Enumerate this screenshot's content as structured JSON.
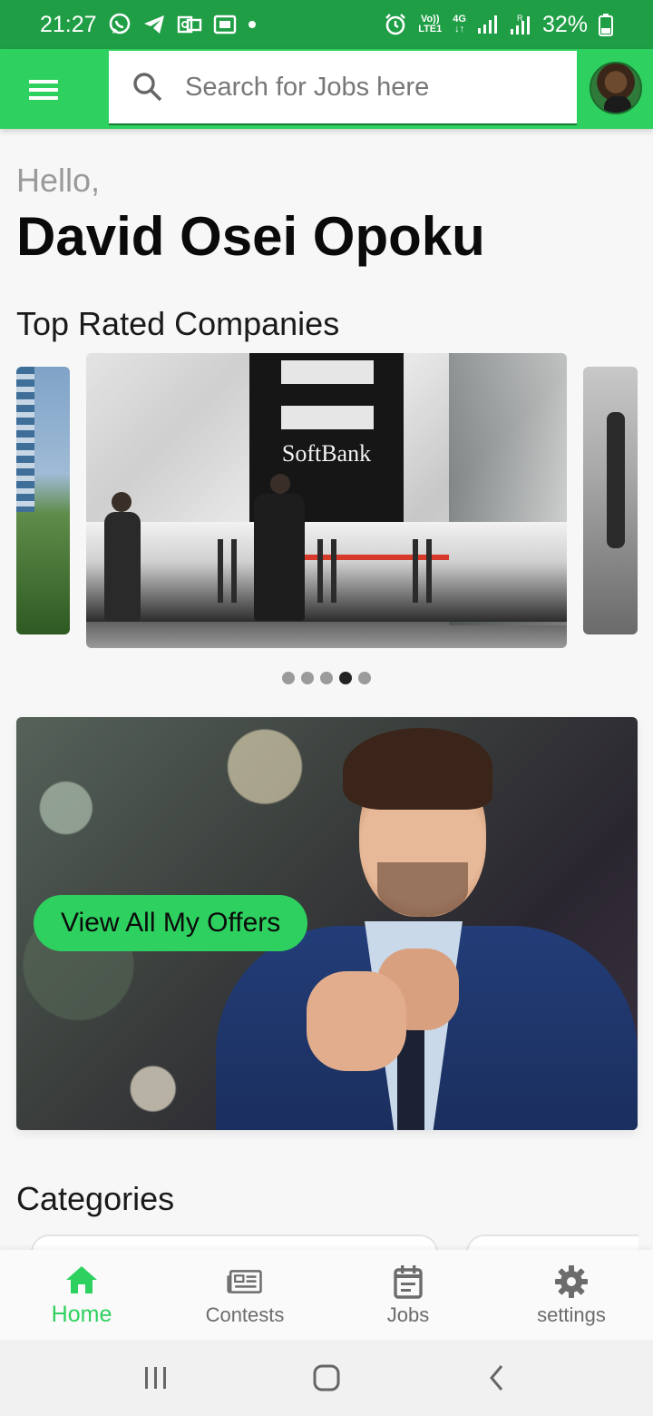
{
  "status_bar": {
    "time": "21:27",
    "network_top": "Vo))",
    "network_bottom": "LTE1",
    "data_type": "4G",
    "battery": "32%",
    "icons": [
      "whatsapp-icon",
      "telegram-icon",
      "outlook-icon",
      "gallery-icon",
      "dot-icon",
      "alarm-icon",
      "volte-icon",
      "signal-icon",
      "signal-roaming-icon",
      "battery-icon"
    ]
  },
  "app_bar": {
    "menu_icon": "hamburger-menu-icon",
    "search_placeholder": "Search for Jobs here",
    "search_icon": "search-icon",
    "avatar": "user-avatar"
  },
  "greeting": {
    "hello": "Hello,",
    "name": "David Osei Opoku"
  },
  "top_companies": {
    "title": "Top Rated Companies",
    "featured_sign": "SoftBank",
    "dots_count": 5,
    "active_dot_index": 3
  },
  "offers": {
    "button_label": "View All My Offers"
  },
  "categories": {
    "title": "Categories"
  },
  "bottom_nav": {
    "items": [
      {
        "label": "Home",
        "icon": "home-icon",
        "active": true
      },
      {
        "label": "Contests",
        "icon": "newspaper-icon",
        "active": false
      },
      {
        "label": "Jobs",
        "icon": "calendar-icon",
        "active": false
      },
      {
        "label": "settings",
        "icon": "gear-icon",
        "active": false
      }
    ]
  },
  "colors": {
    "status_bar": "#1f9e45",
    "primary_green": "#2ed15f",
    "text_dark": "#0a0a0a",
    "text_muted": "#9a9a9a",
    "nav_inactive": "#6c6c6c"
  }
}
